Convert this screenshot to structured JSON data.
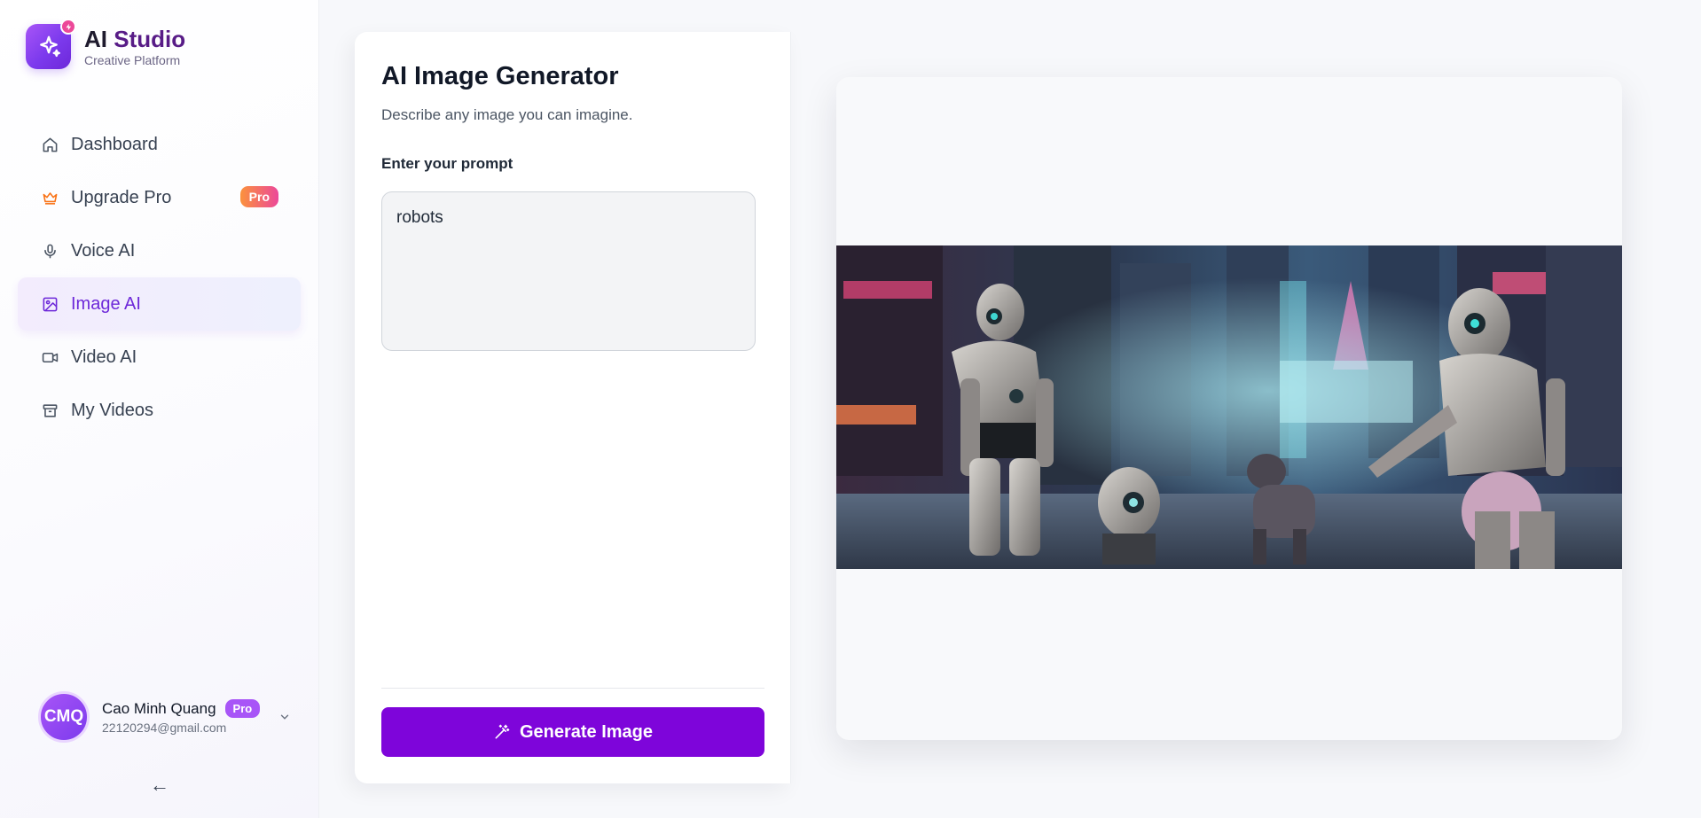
{
  "brand": {
    "title_main": "AI",
    "title_accent": "Studio",
    "subtitle": "Creative Platform"
  },
  "nav": {
    "items": [
      {
        "label": "Dashboard",
        "icon": "home-icon"
      },
      {
        "label": "Upgrade Pro",
        "icon": "crown-icon",
        "badge": "Pro"
      },
      {
        "label": "Voice AI",
        "icon": "microphone-icon"
      },
      {
        "label": "Image AI",
        "icon": "image-icon",
        "active": true
      },
      {
        "label": "Video AI",
        "icon": "video-camera-icon"
      },
      {
        "label": "My Videos",
        "icon": "archive-icon"
      }
    ]
  },
  "user": {
    "initials": "CMQ",
    "name": "Cao Minh Quang",
    "badge": "Pro",
    "email": "22120294@gmail.com"
  },
  "sidebar_footer": {
    "collapse_glyph": "←"
  },
  "generator": {
    "title": "AI Image Generator",
    "subtitle": "Describe any image you can imagine.",
    "prompt_label": "Enter your prompt",
    "prompt_value": "robots",
    "generate_label": "Generate Image"
  },
  "colors": {
    "accent": "#7e05da",
    "active_text": "#6d28d9",
    "pro_badge_from": "#fb923c",
    "pro_badge_to": "#ec4899"
  }
}
